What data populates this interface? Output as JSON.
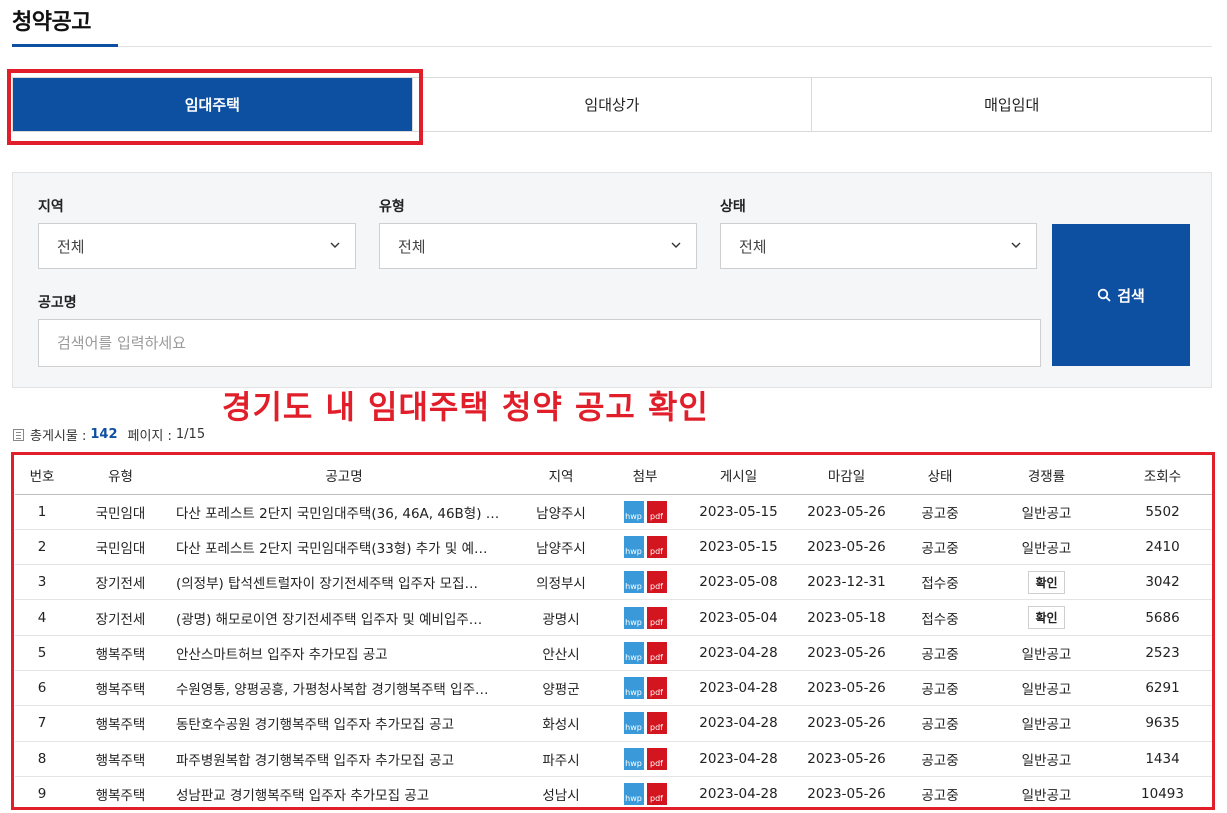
{
  "page": {
    "title": "청약공고"
  },
  "tabs": [
    {
      "label": "임대주택",
      "active": true
    },
    {
      "label": "임대상가",
      "active": false
    },
    {
      "label": "매입임대",
      "active": false
    }
  ],
  "filters": {
    "region": {
      "label": "지역",
      "value": "전체"
    },
    "type": {
      "label": "유형",
      "value": "전체"
    },
    "status": {
      "label": "상태",
      "value": "전체"
    },
    "title": {
      "label": "공고명",
      "placeholder": "검색어를 입력하세요"
    },
    "search_label": "검색"
  },
  "annotation": "경기도 내 임대주택 청약 공고 확인",
  "summary": {
    "total_label": "총게시물 :",
    "total": "142",
    "page_label": "페이지 :",
    "page": "1/15"
  },
  "table": {
    "headers": [
      "번호",
      "유형",
      "공고명",
      "지역",
      "첨부",
      "게시일",
      "마감일",
      "상태",
      "경쟁률",
      "조회수"
    ],
    "attachments": [
      "hwp",
      "pdf"
    ],
    "rows": [
      {
        "no": "1",
        "type": "국민임대",
        "title": "다산 포레스트 2단지 국민임대주택(36, 46A, 46B형) …",
        "region": "남양주시",
        "posted": "2023-05-15",
        "deadline": "2023-05-26",
        "status": "공고중",
        "rate": "일반공고",
        "rate_button": false,
        "views": "5502"
      },
      {
        "no": "2",
        "type": "국민임대",
        "title": "다산 포레스트 2단지 국민임대주택(33형) 추가 및 예…",
        "region": "남양주시",
        "posted": "2023-05-15",
        "deadline": "2023-05-26",
        "status": "공고중",
        "rate": "일반공고",
        "rate_button": false,
        "views": "2410"
      },
      {
        "no": "3",
        "type": "장기전세",
        "title": "(의정부) 탑석센트럴자이 장기전세주택 입주자 모집…",
        "region": "의정부시",
        "posted": "2023-05-08",
        "deadline": "2023-12-31",
        "status": "접수중",
        "rate": "확인",
        "rate_button": true,
        "views": "3042"
      },
      {
        "no": "4",
        "type": "장기전세",
        "title": "(광명) 해모로이연 장기전세주택 입주자 및 예비입주…",
        "region": "광명시",
        "posted": "2023-05-04",
        "deadline": "2023-05-18",
        "status": "접수중",
        "rate": "확인",
        "rate_button": true,
        "views": "5686"
      },
      {
        "no": "5",
        "type": "행복주택",
        "title": "안산스마트허브 입주자 추가모집 공고",
        "region": "안산시",
        "posted": "2023-04-28",
        "deadline": "2023-05-26",
        "status": "공고중",
        "rate": "일반공고",
        "rate_button": false,
        "views": "2523"
      },
      {
        "no": "6",
        "type": "행복주택",
        "title": "수원영통, 양평공흥, 가평청사복합 경기행복주택 입주…",
        "region": "양평군",
        "posted": "2023-04-28",
        "deadline": "2023-05-26",
        "status": "공고중",
        "rate": "일반공고",
        "rate_button": false,
        "views": "6291"
      },
      {
        "no": "7",
        "type": "행복주택",
        "title": "동탄호수공원 경기행복주택 입주자 추가모집 공고",
        "region": "화성시",
        "posted": "2023-04-28",
        "deadline": "2023-05-26",
        "status": "공고중",
        "rate": "일반공고",
        "rate_button": false,
        "views": "9635"
      },
      {
        "no": "8",
        "type": "행복주택",
        "title": "파주병원복합 경기행복주택 입주자 추가모집 공고",
        "region": "파주시",
        "posted": "2023-04-28",
        "deadline": "2023-05-26",
        "status": "공고중",
        "rate": "일반공고",
        "rate_button": false,
        "views": "1434"
      },
      {
        "no": "9",
        "type": "행복주택",
        "title": "성남판교 경기행복주택 입주자 추가모집 공고",
        "region": "성남시",
        "posted": "2023-04-28",
        "deadline": "2023-05-26",
        "status": "공고중",
        "rate": "일반공고",
        "rate_button": false,
        "views": "10493"
      }
    ]
  },
  "colors": {
    "primary": "#0d4fa0",
    "highlight": "#e11f2a",
    "hwp": "#3a9ad9",
    "pdf": "#d2151e"
  }
}
